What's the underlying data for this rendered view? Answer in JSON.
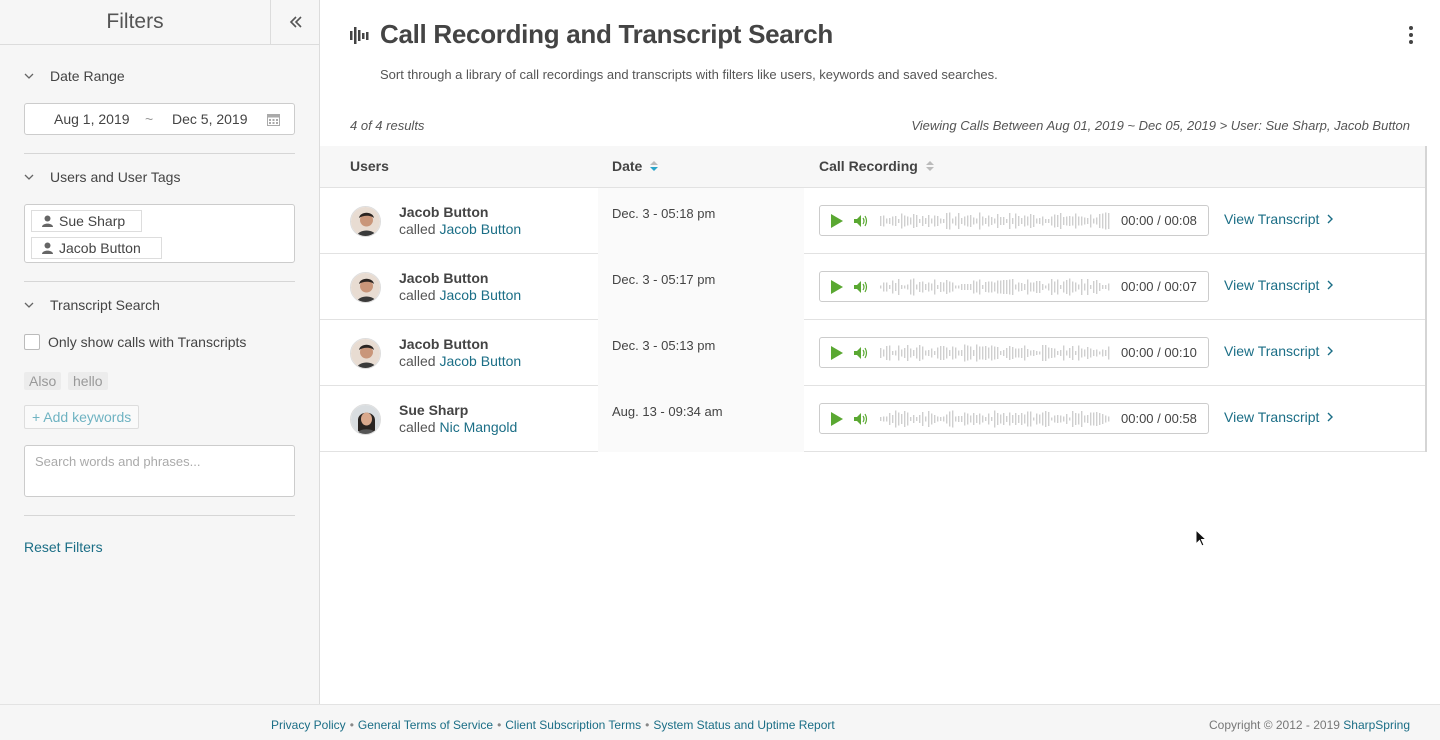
{
  "sidebar": {
    "title": "Filters",
    "collapse_icon": "double-chevron-left-icon",
    "date_range": {
      "heading": "Date Range",
      "start": "Aug 1, 2019",
      "separator": "~",
      "end": "Dec 5, 2019",
      "icon": "calendar-icon"
    },
    "users": {
      "heading": "Users and User Tags",
      "tags": [
        "Sue Sharp",
        "Jacob Button"
      ]
    },
    "transcript": {
      "heading": "Transcript Search",
      "checkbox_label": "Only show calls with Transcripts",
      "checkbox_checked": false,
      "keywords": [
        "Also",
        "hello"
      ],
      "add_keywords_label": "+ Add keywords",
      "search_placeholder": "Search words and phrases..."
    },
    "reset_label": "Reset Filters"
  },
  "main": {
    "title": "Call Recording and Transcript Search",
    "subtitle": "Sort through a library of call recordings and transcripts with filters like users, keywords and saved searches.",
    "results_count": "4 of 4 results",
    "viewing_text": "Viewing Calls Between Aug 01, 2019 ~ Dec 05, 2019 > User: Sue Sharp, Jacob Button",
    "columns": {
      "users": "Users",
      "date": "Date",
      "recording": "Call Recording"
    },
    "rows": [
      {
        "user": "Jacob Button",
        "called_prefix": "called",
        "called_name": "Jacob Button",
        "date": "Dec. 3 - 05:18 pm",
        "time": "00:00 / 00:08",
        "transcript_label": "View Transcript"
      },
      {
        "user": "Jacob Button",
        "called_prefix": "called",
        "called_name": "Jacob Button",
        "date": "Dec. 3 - 05:17 pm",
        "time": "00:00 / 00:07",
        "transcript_label": "View Transcript"
      },
      {
        "user": "Jacob Button",
        "called_prefix": "called",
        "called_name": "Jacob Button",
        "date": "Dec. 3 - 05:13 pm",
        "time": "00:00 / 00:10",
        "transcript_label": "View Transcript"
      },
      {
        "user": "Sue Sharp",
        "called_prefix": "called",
        "called_name": "Nic Mangold",
        "date": "Aug. 13 - 09:34 am",
        "time": "00:00 / 00:58",
        "transcript_label": "View Transcript"
      }
    ]
  },
  "footer": {
    "links": [
      "Privacy Policy",
      "General Terms of Service",
      "Client Subscription Terms",
      "System Status and Uptime Report"
    ],
    "link_separator": "•",
    "copyright": "Copyright © 2012 - 2019",
    "brand": "SharpSpring"
  },
  "colors": {
    "accent_link": "#1b6e86",
    "play_green": "#5aa832",
    "sidebar_bg": "#f6f6f6"
  }
}
